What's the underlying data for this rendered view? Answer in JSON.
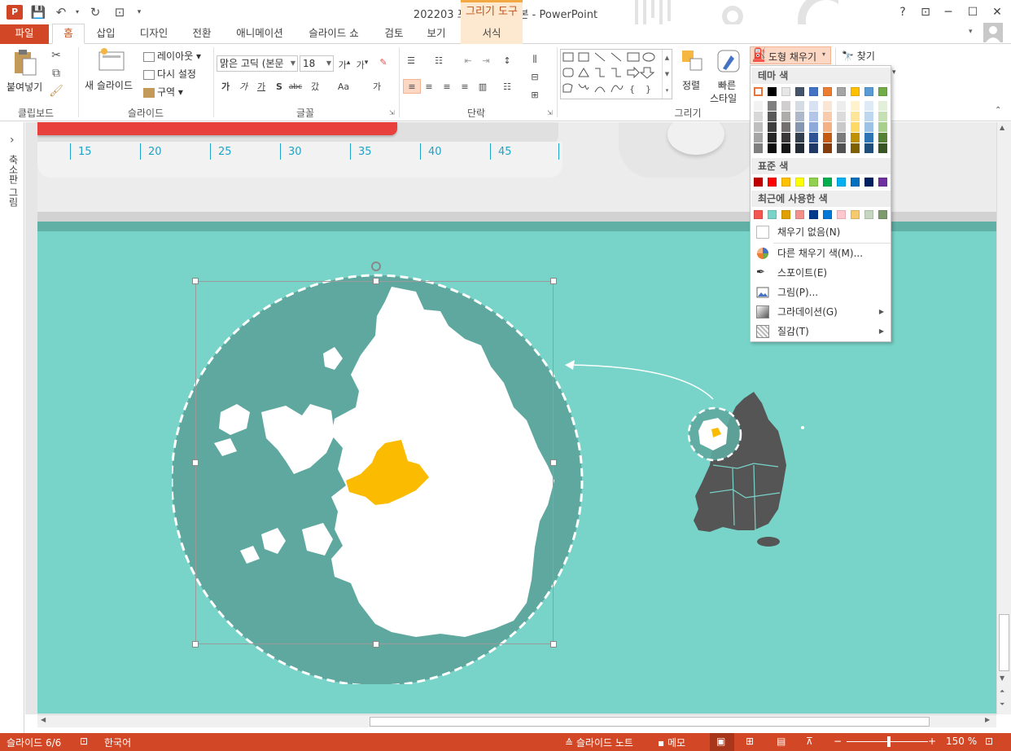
{
  "window": {
    "title": "202203 포스팅용 완성본 - PowerPoint",
    "app_badge": "P",
    "context_tab_group": "그리기 도구",
    "help": "?",
    "controls": [
      "─",
      "☐",
      "✕"
    ]
  },
  "tabs": [
    "파일",
    "홈",
    "삽입",
    "디자인",
    "전환",
    "애니메이션",
    "슬라이드 쇼",
    "검토",
    "보기",
    "서식"
  ],
  "ribbon": {
    "clipboard": {
      "paste": "붙여넣기",
      "label": "클립보드"
    },
    "slides": {
      "new_slide": "새 슬라이드",
      "layout": "레이아웃",
      "reset": "다시 설정",
      "section": "구역",
      "label": "슬라이드"
    },
    "font": {
      "font_name": "맑은 고딕 (본문",
      "font_size": "18",
      "label": "글꼴",
      "buttons": [
        "가",
        "가",
        "가",
        "S",
        "abc",
        "갔",
        "Aa",
        "가"
      ]
    },
    "paragraph": {
      "label": "단락"
    },
    "drawing": {
      "arrange": "정렬",
      "quick_styles": "빠른",
      "quick_styles_2": "스타일",
      "label": "그리기",
      "shape_fill": "도형 채우기"
    },
    "editing": {
      "find": "찾기"
    }
  },
  "sidepane": {
    "label": "축소판 그림",
    "toggle": "›"
  },
  "ruler_marks": [
    "15",
    "20",
    "25",
    "30",
    "35",
    "40",
    "45"
  ],
  "fill_menu": {
    "theme_colors_label": "테마 색",
    "standard_colors_label": "표준 색",
    "recent_colors_label": "최근에 사용한 색",
    "no_fill": "채우기 없음(N)",
    "more_colors": "다른 채우기 색(M)...",
    "eyedropper": "스포이트(E)",
    "picture": "그림(P)...",
    "gradient": "그라데이션(G)",
    "texture": "질감(T)",
    "theme_top_row": [
      "#ffffff",
      "#000000",
      "#e7e6e6",
      "#44546a",
      "#4472c4",
      "#ed7d31",
      "#a5a5a5",
      "#ffc000",
      "#5b9bd5",
      "#70ad47"
    ],
    "theme_shades": [
      [
        "#f2f2f2",
        "#7f7f7f",
        "#d0cece",
        "#d6dce4",
        "#d9e2f3",
        "#fbe5d5",
        "#ededed",
        "#fff2cc",
        "#deebf6",
        "#e2efd9"
      ],
      [
        "#d8d8d8",
        "#595959",
        "#aeabab",
        "#adb9ca",
        "#b4c6e7",
        "#f7cbac",
        "#dbdbdb",
        "#fee599",
        "#bdd7ee",
        "#c5e0b3"
      ],
      [
        "#bfbfbf",
        "#3f3f3f",
        "#757070",
        "#8496b0",
        "#8eaadb",
        "#f4b183",
        "#c9c9c9",
        "#ffd965",
        "#9cc3e5",
        "#a8d08d"
      ],
      [
        "#a5a5a5",
        "#262626",
        "#3a3838",
        "#323f4f",
        "#2f5496",
        "#c55a11",
        "#7b7b7b",
        "#bf9000",
        "#2e75b5",
        "#538135"
      ],
      [
        "#7f7f7f",
        "#0c0c0c",
        "#171616",
        "#222a35",
        "#1f3864",
        "#833c0b",
        "#525252",
        "#7f6000",
        "#1e4e79",
        "#375623"
      ]
    ],
    "standard": [
      "#c00000",
      "#ff0000",
      "#ffc000",
      "#ffff00",
      "#92d050",
      "#00b050",
      "#00b0f0",
      "#0070c0",
      "#002060",
      "#7030a0"
    ],
    "recent": [
      "#f4564f",
      "#78d4c9",
      "#e0a000",
      "#f4908c",
      "#003a8c",
      "#0078d7",
      "#ffc7ce",
      "#f7c96d",
      "#c4d5c0",
      "#7e9b6e"
    ]
  },
  "status": {
    "slide_info": "슬라이드 6/6",
    "language": "한국어",
    "notes": "슬라이드 노트",
    "comments": "메모",
    "zoom": "150 %"
  },
  "slide": {
    "background": "#78d4c9",
    "circle_fill": "#5ea89f",
    "highlight": "#fbbb00",
    "korea_fill": "#555555"
  }
}
